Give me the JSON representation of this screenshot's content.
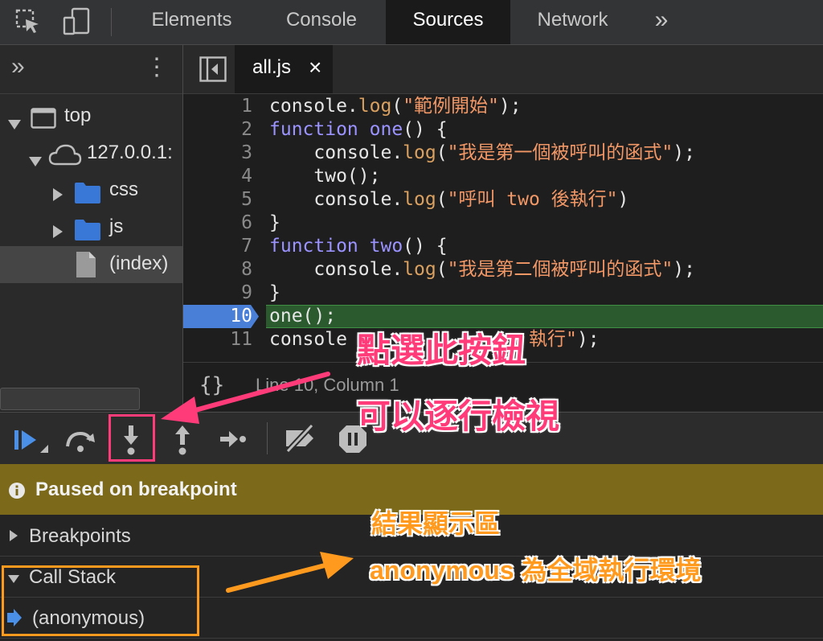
{
  "tabs": {
    "elements": "Elements",
    "console": "Console",
    "sources": "Sources",
    "network": "Network",
    "more": "»"
  },
  "navigator": {
    "more": "»",
    "menu": "⋮",
    "top": "top",
    "host": "127.0.0.1:",
    "css": "css",
    "js": "js",
    "index": "(index)"
  },
  "editor": {
    "file_tab": "all.js",
    "close": "×",
    "lines": [
      {
        "n": "1"
      },
      {
        "n": "2"
      },
      {
        "n": "3"
      },
      {
        "n": "4"
      },
      {
        "n": "5"
      },
      {
        "n": "6"
      },
      {
        "n": "7"
      },
      {
        "n": "8"
      },
      {
        "n": "9"
      },
      {
        "n": "10"
      },
      {
        "n": "11"
      }
    ],
    "code": {
      "l1a": "console.",
      "l1b": "log",
      "l1c": "(",
      "l1d": "\"範例開始\"",
      "l1e": ");",
      "l2a": "function",
      "l2b": " one",
      "l2c": "() {",
      "l3a": "    console.",
      "l3b": "log",
      "l3c": "(",
      "l3d": "\"我是第一個被呼叫的函式\"",
      "l3e": ");",
      "l4": "    two();",
      "l5a": "    console.",
      "l5b": "log",
      "l5c": "(",
      "l5d": "\"呼叫 two 後執行\"",
      "l5e": ")",
      "l6": "}",
      "l7a": "function",
      "l7b": " two",
      "l7c": "() {",
      "l8a": "    console.",
      "l8b": "log",
      "l8c": "(",
      "l8d": "\"我是第二個被呼叫的函式\"",
      "l8e": ");",
      "l9": "}",
      "l10": "one();",
      "l11a": "console",
      "l11b": "執行\"",
      "l11c": ");"
    },
    "status_braces": "{}",
    "status": "Line 10, Column 1"
  },
  "debugger": {
    "paused": "Paused on breakpoint",
    "breakpoints": "Breakpoints",
    "call_stack": "Call Stack",
    "frame": "(anonymous)"
  },
  "annotations": {
    "pink1": "點選此按鈕",
    "pink2": "可以逐行檢視",
    "orange1": "結果顯示區",
    "orange2": "anonymous 為全域執行環境"
  },
  "colors": {
    "breakpoint": "#4a7fd8",
    "exec_line": "#2a5a2e",
    "paused_bg": "#7c6a1a",
    "pink": "#ff3b7a",
    "orange": "#ff9a1e"
  }
}
